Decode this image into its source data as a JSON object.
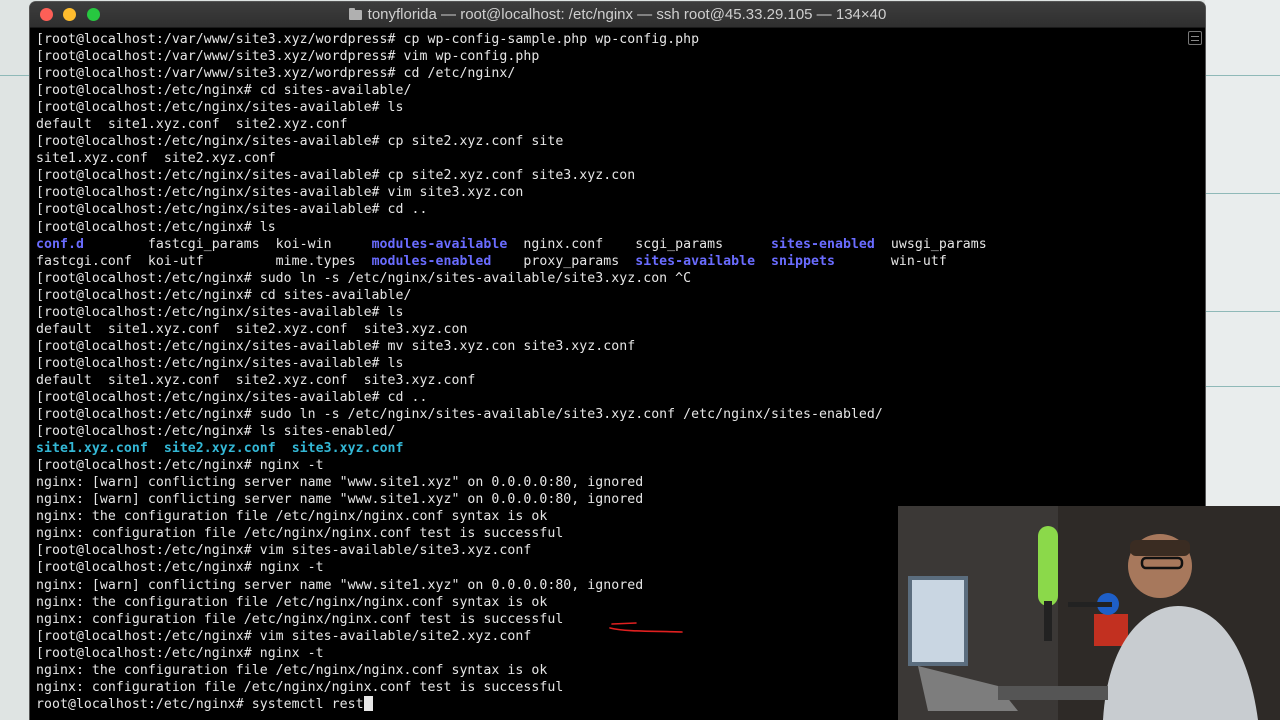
{
  "window": {
    "title": "tonyflorida — root@localhost: /etc/nginx — ssh root@45.33.29.105 — 134×40"
  },
  "terminal": {
    "lines": [
      [
        {
          "t": "[root@localhost:/var/www/site3.xyz/wordpress# cp wp-config-sample.php wp-config.php"
        }
      ],
      [
        {
          "t": "[root@localhost:/var/www/site3.xyz/wordpress# vim wp-config.php"
        }
      ],
      [
        {
          "t": "[root@localhost:/var/www/site3.xyz/wordpress# cd /etc/nginx/"
        }
      ],
      [
        {
          "t": "[root@localhost:/etc/nginx# cd sites-available/"
        }
      ],
      [
        {
          "t": "[root@localhost:/etc/nginx/sites-available# ls"
        }
      ],
      [
        {
          "t": "default  site1.xyz.conf  site2.xyz.conf"
        }
      ],
      [
        {
          "t": "[root@localhost:/etc/nginx/sites-available# cp site2.xyz.conf site"
        }
      ],
      [
        {
          "t": "site1.xyz.conf  site2.xyz.conf"
        }
      ],
      [
        {
          "t": "[root@localhost:/etc/nginx/sites-available# cp site2.xyz.conf site3.xyz.con"
        }
      ],
      [
        {
          "t": "[root@localhost:/etc/nginx/sites-available# vim site3.xyz.con"
        }
      ],
      [
        {
          "t": "[root@localhost:/etc/nginx/sites-available# cd .."
        }
      ],
      [
        {
          "t": "[root@localhost:/etc/nginx# ls"
        }
      ],
      [
        {
          "t": "conf.d",
          "c": "c-blue"
        },
        {
          "t": "        fastcgi_params  koi-win     "
        },
        {
          "t": "modules-available",
          "c": "c-blue"
        },
        {
          "t": "  nginx.conf    scgi_params      "
        },
        {
          "t": "sites-enabled",
          "c": "c-blue"
        },
        {
          "t": "  uwsgi_params"
        }
      ],
      [
        {
          "t": "fastcgi.conf  koi-utf         mime.types  "
        },
        {
          "t": "modules-enabled",
          "c": "c-blue"
        },
        {
          "t": "    proxy_params  "
        },
        {
          "t": "sites-available",
          "c": "c-blue"
        },
        {
          "t": "  "
        },
        {
          "t": "snippets",
          "c": "c-blue"
        },
        {
          "t": "       win-utf"
        }
      ],
      [
        {
          "t": "[root@localhost:/etc/nginx# sudo ln -s /etc/nginx/sites-available/site3.xyz.con ^C"
        }
      ],
      [
        {
          "t": "[root@localhost:/etc/nginx# cd sites-available/"
        }
      ],
      [
        {
          "t": "[root@localhost:/etc/nginx/sites-available# ls"
        }
      ],
      [
        {
          "t": "default  site1.xyz.conf  site2.xyz.conf  site3.xyz.con"
        }
      ],
      [
        {
          "t": "[root@localhost:/etc/nginx/sites-available# mv site3.xyz.con site3.xyz.conf"
        }
      ],
      [
        {
          "t": "[root@localhost:/etc/nginx/sites-available# ls"
        }
      ],
      [
        {
          "t": "default  site1.xyz.conf  site2.xyz.conf  site3.xyz.conf"
        }
      ],
      [
        {
          "t": "[root@localhost:/etc/nginx/sites-available# cd .."
        }
      ],
      [
        {
          "t": "[root@localhost:/etc/nginx# sudo ln -s /etc/nginx/sites-available/site3.xyz.conf /etc/nginx/sites-enabled/"
        }
      ],
      [
        {
          "t": "[root@localhost:/etc/nginx# ls sites-enabled/"
        }
      ],
      [
        {
          "t": "site1.xyz.conf",
          "c": "c-cyan"
        },
        {
          "t": "  "
        },
        {
          "t": "site2.xyz.conf",
          "c": "c-cyan"
        },
        {
          "t": "  "
        },
        {
          "t": "site3.xyz.conf",
          "c": "c-cyan"
        }
      ],
      [
        {
          "t": "[root@localhost:/etc/nginx# nginx -t"
        }
      ],
      [
        {
          "t": "nginx: [warn] conflicting server name \"www.site1.xyz\" on 0.0.0.0:80, ignored"
        }
      ],
      [
        {
          "t": "nginx: [warn] conflicting server name \"www.site1.xyz\" on 0.0.0.0:80, ignored"
        }
      ],
      [
        {
          "t": "nginx: the configuration file /etc/nginx/nginx.conf syntax is ok"
        }
      ],
      [
        {
          "t": "nginx: configuration file /etc/nginx/nginx.conf test is successful"
        }
      ],
      [
        {
          "t": "[root@localhost:/etc/nginx# vim sites-available/site3.xyz.conf"
        }
      ],
      [
        {
          "t": "[root@localhost:/etc/nginx# nginx -t"
        }
      ],
      [
        {
          "t": "nginx: [warn] conflicting server name \"www.site1.xyz\" on 0.0.0.0:80, ignored"
        }
      ],
      [
        {
          "t": "nginx: the configuration file /etc/nginx/nginx.conf syntax is ok"
        }
      ],
      [
        {
          "t": "nginx: configuration file /etc/nginx/nginx.conf test is successful"
        }
      ],
      [
        {
          "t": "[root@localhost:/etc/nginx# vim sites-available/site2.xyz.conf"
        }
      ],
      [
        {
          "t": "[root@localhost:/etc/nginx# nginx -t"
        }
      ],
      [
        {
          "t": "nginx: the configuration file /etc/nginx/nginx.conf syntax is ok"
        }
      ],
      [
        {
          "t": "nginx: configuration file /etc/nginx/nginx.conf test is successful"
        }
      ],
      [
        {
          "t": "root@localhost:/etc/nginx# systemctl rest"
        }
      ]
    ]
  },
  "icons": {
    "close": "close-traffic-light-icon",
    "minimize": "minimize-traffic-light-icon",
    "maximize": "maximize-traffic-light-icon",
    "folder": "folder-icon",
    "scrollbar": "scrollbar-menu-icon"
  },
  "colors": {
    "directory": "#6a6cff",
    "symlink": "#33b8d6",
    "annotation": "#e02020"
  }
}
